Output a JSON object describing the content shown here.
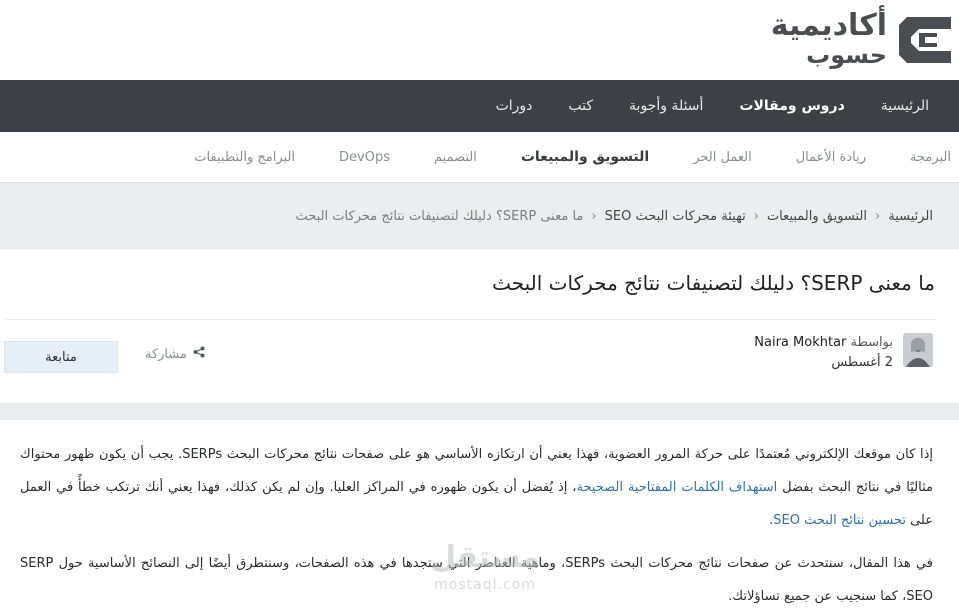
{
  "logo": {
    "line1": "أكاديمية",
    "line2": "حسوب"
  },
  "primary_nav": [
    {
      "label": "الرئيسية"
    },
    {
      "label": "دروس ومقالات",
      "active": true
    },
    {
      "label": "أسئلة وأجوبة"
    },
    {
      "label": "كتب"
    },
    {
      "label": "دورات"
    }
  ],
  "secondary_nav": [
    {
      "label": "البرمجة"
    },
    {
      "label": "ريادة الأعمال"
    },
    {
      "label": "العمل الحر"
    },
    {
      "label": "التسويق والمبيعات",
      "active": true
    },
    {
      "label": "التصميم"
    },
    {
      "label": "DevOps"
    },
    {
      "label": "البرامج والتطبيقات"
    }
  ],
  "breadcrumb": [
    {
      "label": "الرئيسية"
    },
    {
      "label": "التسويق والمبيعات"
    },
    {
      "label": "تهيئة محركات البحث SEO"
    },
    {
      "label": "ما معنى SERP؟ دليلك لتصنيفات نتائج محركات البحث",
      "current": true
    }
  ],
  "breadcrumb_separator": "‹",
  "article": {
    "title": "ما معنى SERP؟ دليلك لتصنيفات نتائج محركات البحث",
    "by_label": "بواسطة",
    "author": "Naira Mokhtar",
    "date": "2 أغسطس",
    "share_label": "مشاركة",
    "follow_label": "متابعة"
  },
  "body": {
    "p1_a": "إذا كان موقعك الإلكتروني مُعتمدًا على حركة المرور العضوية، فهذا يعني أن ارتكازه الأساسي هو على صفحات نتائج محركات البحث SERPs. يجب أن يكون ظهور محتواك مثاليًا في نتائج البحث بفضل ",
    "p1_link1": "استهداف الكلمات المفتاحية الصحيحة",
    "p1_b": "، إذ يُفضل أن يكون ظهوره في المراكز العليا. وإن لم يكن كذلك، فهذا يعني أنك ترتكب خطأً في العمل على ",
    "p1_link2": "تحسين نتائج البحث SEO",
    "p1_c": ".",
    "p2": "في هذا المقال، سنتحدث عن صفحات نتائج محركات البحث SERPs، وماهية العناصر التي ستجدها في هذه الصفحات، وسنتطرق أيضًا إلى النصائح الأساسية حول SERP SEO، كما سنجيب عن جميع تساؤلاتك."
  },
  "watermark": {
    "ar": "مستقل",
    "en": "mostaql.com"
  },
  "colors": {
    "primary_nav_bg": "#3d4045",
    "link": "#2f6fb0",
    "follow_bg": "#e6eef8"
  }
}
